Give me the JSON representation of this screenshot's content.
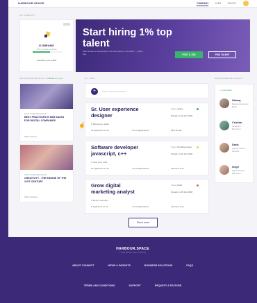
{
  "nav": {
    "brand": "HARBOUR.SPACE",
    "links": [
      "COMPANY",
      "JOBS",
      "TALENT"
    ],
    "active_index": 0
  },
  "sections": {
    "company": "MY COMPANY",
    "blog": "RECOMMENDED BLOG POSTS",
    "view_all": "View all posts",
    "jobs": "MY JOBS",
    "talent": "RECOMMENDED TALENT"
  },
  "company": {
    "name": "E-DREAMS",
    "subtitle": "45% of profile complete",
    "link": "Complete your profile",
    "progress": 0.6
  },
  "hero": {
    "title": "Start hiring 1% top talent",
    "subtitle": "Offer access to thousands of the best talent in the world — 100% free",
    "post_job": "POST A JOB",
    "find_talent": "FIND TALENT"
  },
  "posts": [
    {
      "category": "HOW TO BE EFFECTIVE",
      "title": "BEST PRACTICES IN B2B SALES FOR DIGITAL COMPANIES",
      "author": "Nikita Fedorov"
    },
    {
      "category": "HOW TO BE EFFECTIVE",
      "title": "CREATIVITY - THE ENGINE OF THE 21ST CENTURY",
      "author": "Svitlo Sokolova"
    }
  ],
  "new_post_placeholder": "Post a new job description",
  "jobs": [
    {
      "title": "Sr. User experience designer",
      "location": "Barcelona, Spain",
      "applicants": "34 Applicants so far",
      "responses": "8 new applications",
      "status_label": "Status",
      "status": "Active",
      "date_label": "Posted on",
      "date": "20 Jan 2018",
      "extra": "65% fill rate",
      "dot": "#3bb56b"
    },
    {
      "title": "Software developer javascript, c++",
      "location": "New york, USA",
      "applicants": "16 Applicants so far",
      "responses": "4 new applications",
      "status_label": "Status",
      "status": "Pending review",
      "date_label": "Posted on",
      "date": "22 Jan 2018",
      "extra": "Interview soon",
      "dot": "#f5c84b"
    },
    {
      "title": "Grow digital marketing analyst",
      "location": "Berlin, Germany",
      "applicants": "5 Applicants so far",
      "responses": "2 new applications",
      "status_label": "Status",
      "status": "Draft",
      "date_label": "Posted on",
      "date": "25 Jan 2018",
      "extra": "Interview soon",
      "dot": "#e0635a"
    }
  ],
  "show_more": "Show more",
  "talent": {
    "head": "+ Invite talent",
    "people": [
      {
        "name": "Nikolaj",
        "role": "Backend developer",
        "location": "Berlin"
      },
      {
        "name": "Cristina",
        "role": "Developer",
        "location": "Barcelona"
      },
      {
        "name": "Daria",
        "role": "Digital marketer",
        "location": "Moscow"
      },
      {
        "name": "Sinye",
        "role": "Digital designer",
        "location": "Barcelona"
      }
    ]
  },
  "footer": {
    "brand": "HARBOUR.SPACE",
    "tagline": "© 2018 Harbour.Space University",
    "row1": [
      "ABOUT CONNECT",
      "NEWS & INSIGHTS",
      "BUSINESS SOLUTIONS",
      "FAQS"
    ],
    "row2": [
      "TERMS AND CONDITIONS",
      "SUPPORT",
      "REQUEST A FEATURE"
    ]
  }
}
